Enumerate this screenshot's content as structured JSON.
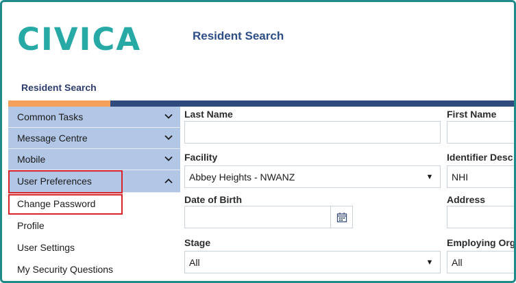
{
  "header": {
    "logo_text": "CIVICA",
    "app_title": "Resident Search"
  },
  "breadcrumb": "Resident Search",
  "colors": {
    "brand_teal": "#27a9a6",
    "nav_blue": "#2f4a7c",
    "accent_orange": "#f3a05b",
    "menu_bg": "#b2c6e6",
    "highlight_red": "#d8232a"
  },
  "sidebar": {
    "groups": [
      {
        "label": "Common Tasks",
        "icon": "chevron-down-icon"
      },
      {
        "label": "Message Centre",
        "icon": "chevron-down-icon"
      },
      {
        "label": "Mobile",
        "icon": "chevron-down-icon"
      },
      {
        "label": "User Preferences",
        "icon": "chevron-up-icon"
      }
    ],
    "sub_items": [
      {
        "label": "Change Password"
      },
      {
        "label": "Profile"
      },
      {
        "label": "User Settings"
      },
      {
        "label": "My Security Questions"
      }
    ]
  },
  "form": {
    "last_name": {
      "label": "Last Name",
      "value": ""
    },
    "first_name": {
      "label": "First Name",
      "value": ""
    },
    "facility": {
      "label": "Facility",
      "value": "Abbey Heights - NWANZ"
    },
    "identifier_desc": {
      "label": "Identifier Desc",
      "value": "NHI"
    },
    "date_of_birth": {
      "label": "Date of Birth",
      "value": ""
    },
    "address": {
      "label": "Address",
      "value": ""
    },
    "stage": {
      "label": "Stage",
      "value": "All"
    },
    "employing_org": {
      "label": "Employing Org",
      "value": "All"
    }
  }
}
